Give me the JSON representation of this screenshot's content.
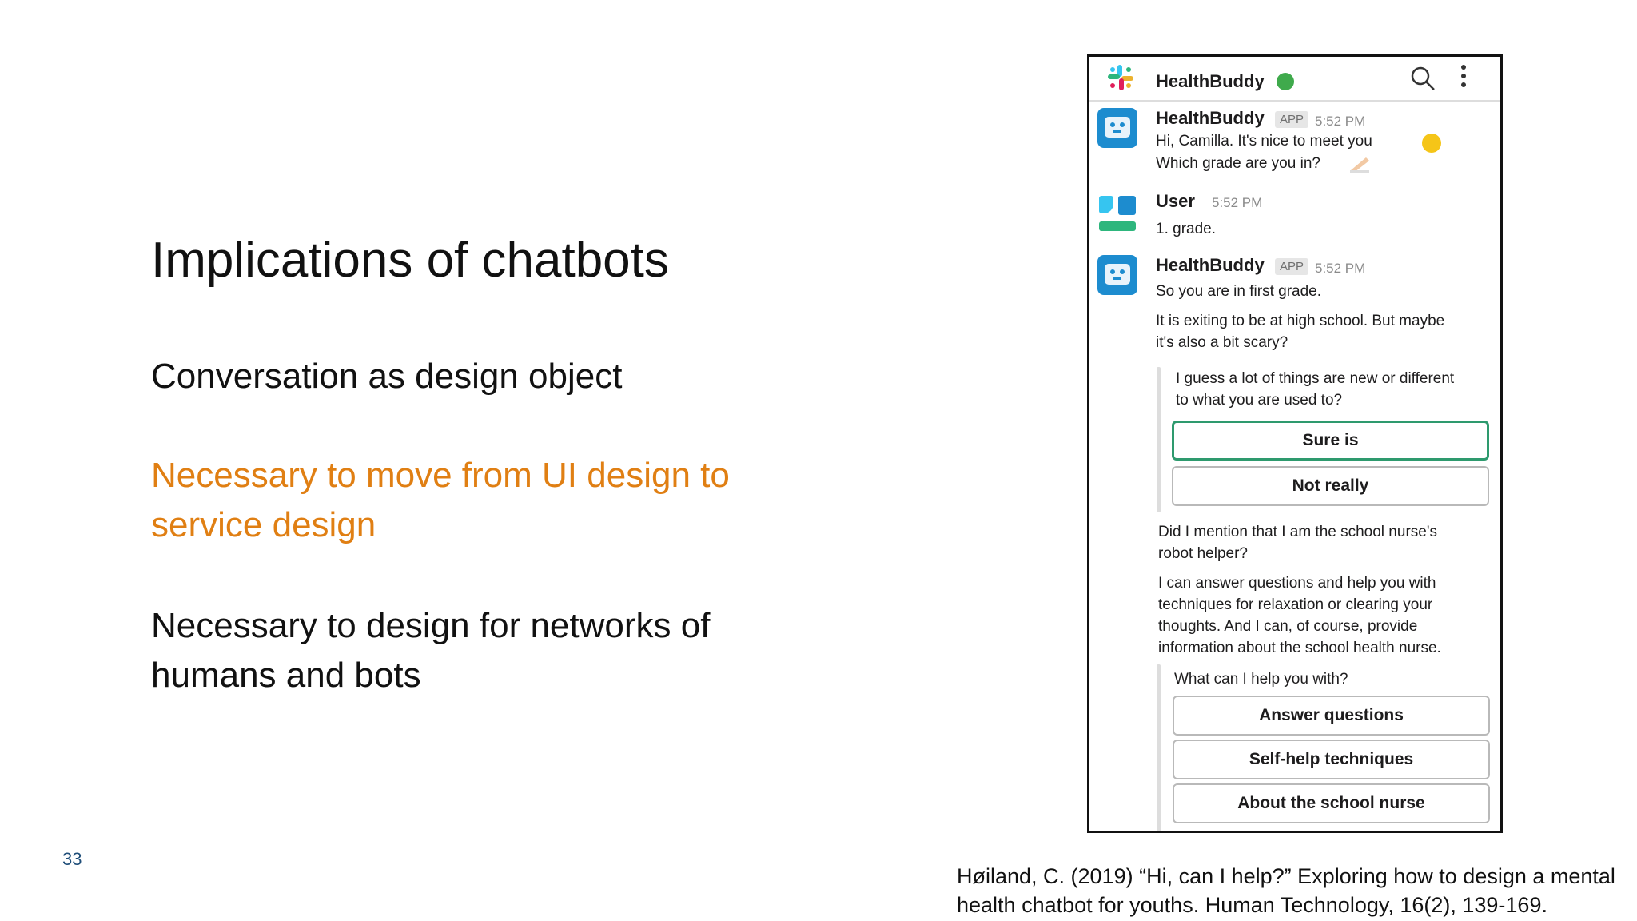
{
  "slide": {
    "title": "Implications of chatbots",
    "bullet1": "Conversation as design object",
    "bullet2_line1": "Necessary to move from UI design to",
    "bullet2_line2": "service design",
    "bullet3_line1": "Necessary to design for networks of",
    "bullet3_line2": "humans and bots",
    "page_number": "33",
    "citation_line1": "Høiland, C. (2019) “Hi, can I help?” Exploring how to design a mental",
    "citation_line2": "health chatbot for youths. Human Technology, 16(2), 139-169.",
    "highlight_color": "#e07f13"
  },
  "chat": {
    "channel_name": "HealthBuddy",
    "status": "online",
    "icons": [
      "slack-logo",
      "search-icon",
      "more-icon"
    ],
    "messages": [
      {
        "sender": "HealthBuddy",
        "badge": "APP",
        "time": "5:52 PM",
        "lines": [
          "Hi, Camilla. It's nice to meet you",
          "Which grade are you in?"
        ]
      },
      {
        "sender": "User",
        "time": "5:52 PM",
        "lines": [
          "1. grade."
        ]
      },
      {
        "sender": "HealthBuddy",
        "badge": "APP",
        "time": "5:52 PM",
        "lines": [
          "So you are in first grade.",
          "It is exiting to be at high school. But maybe",
          "it's also a bit scary?"
        ],
        "attachment": {
          "lines": [
            "I guess a lot of things are new or different",
            "to what you are used to?"
          ],
          "buttons": [
            "Sure is",
            "Not really"
          ]
        },
        "after_lines": [
          "Did I mention that I am the school nurse's",
          "robot helper?",
          "I can answer questions and help you with",
          "techniques for relaxation or clearing your",
          "thoughts. And I can, of course, provide",
          "information about the school health nurse."
        ],
        "attachment2": {
          "prompt": "What can I help you with?",
          "buttons": [
            "Answer questions",
            "Self-help techniques",
            "About the school nurse"
          ]
        }
      }
    ],
    "selected_button_color": "#2e9a6e"
  }
}
